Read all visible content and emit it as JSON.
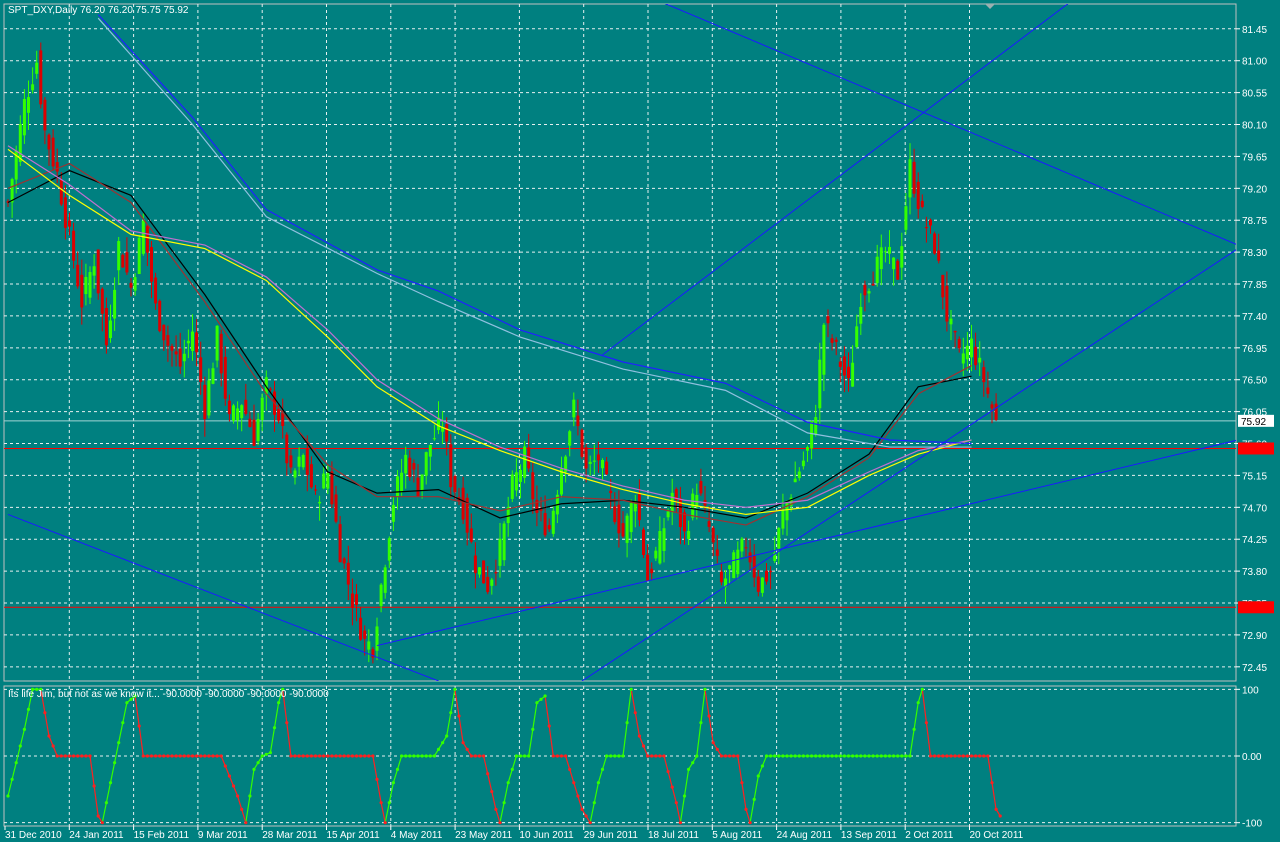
{
  "chart_data": [
    {
      "type": "candlestick",
      "title": "SPT_DXY,Daily  76.20 76.20 75.75 75.92",
      "ylim": [
        72.25,
        81.8
      ],
      "y_ticks": [
        "81.45",
        "81.00",
        "80.55",
        "80.10",
        "79.65",
        "79.20",
        "78.75",
        "78.30",
        "77.85",
        "77.40",
        "76.95",
        "76.50",
        "76.05",
        "75.60",
        "75.15",
        "74.70",
        "74.25",
        "73.80",
        "73.35",
        "72.90",
        "72.45"
      ],
      "x_ticks": [
        "31 Dec 2010",
        "24 Jan 2011",
        "15 Feb 2011",
        "9 Mar 2011",
        "28 Mar 2011",
        "15 Apr 2011",
        "4 May 2011",
        "23 May 2011",
        "10 Jun 2011",
        "29 Jun 2011",
        "18 Jul 2011",
        "5 Aug 2011",
        "24 Aug 2011",
        "13 Sep 2011",
        "2 Oct 2011",
        "20 Oct 2011"
      ],
      "price_labels": [
        {
          "text": "75.92",
          "value": 75.92,
          "color": "#ffffff",
          "text_color": "#000000"
        },
        {
          "text": "75.53",
          "value": 75.53,
          "color": "#ff0000",
          "text_color": "#ff0000"
        },
        {
          "text": "73.29",
          "value": 73.29,
          "color": "#ff0000",
          "text_color": "#ff0000"
        }
      ],
      "horizontal_lines": [
        {
          "value": 75.53,
          "color": "#ff0000"
        },
        {
          "value": 73.29,
          "color": "#ff0000"
        },
        {
          "value": 75.92,
          "color": "#9fd4d4"
        }
      ],
      "bar_up_color": "#33ff00",
      "bar_down_color": "#dd0000",
      "close_points": [
        [
          0,
          79.0
        ],
        [
          4,
          80.4
        ],
        [
          7,
          81.0
        ],
        [
          9,
          80.0
        ],
        [
          12,
          79.4
        ],
        [
          15,
          78.5
        ],
        [
          18,
          77.6
        ],
        [
          21,
          78.2
        ],
        [
          24,
          77.0
        ],
        [
          27,
          78.4
        ],
        [
          30,
          77.8
        ],
        [
          33,
          78.7
        ],
        [
          36,
          77.5
        ],
        [
          39,
          77.0
        ],
        [
          42,
          76.7
        ],
        [
          45,
          77.2
        ],
        [
          48,
          76.1
        ],
        [
          51,
          77.1
        ],
        [
          54,
          75.9
        ],
        [
          57,
          76.2
        ],
        [
          60,
          75.7
        ],
        [
          63,
          76.4
        ],
        [
          66,
          76.0
        ],
        [
          69,
          75.1
        ],
        [
          72,
          75.4
        ],
        [
          75,
          74.8
        ],
        [
          78,
          75.2
        ],
        [
          81,
          74.1
        ],
        [
          84,
          73.4
        ],
        [
          87,
          72.8
        ],
        [
          89,
          72.75
        ],
        [
          91,
          73.6
        ],
        [
          94,
          74.8
        ],
        [
          97,
          75.4
        ],
        [
          100,
          75.0
        ],
        [
          103,
          75.6
        ],
        [
          106,
          75.9
        ],
        [
          108,
          75.1
        ],
        [
          111,
          74.7
        ],
        [
          114,
          73.9
        ],
        [
          117,
          73.6
        ],
        [
          120,
          74.1
        ],
        [
          123,
          75.0
        ],
        [
          126,
          75.4
        ],
        [
          129,
          74.6
        ],
        [
          132,
          74.4
        ],
        [
          135,
          75.3
        ],
        [
          138,
          76.1
        ],
        [
          141,
          75.2
        ],
        [
          144,
          75.4
        ],
        [
          147,
          74.8
        ],
        [
          150,
          74.3
        ],
        [
          153,
          74.9
        ],
        [
          156,
          73.7
        ],
        [
          159,
          74.2
        ],
        [
          162,
          74.9
        ],
        [
          165,
          74.3
        ],
        [
          168,
          75.0
        ],
        [
          171,
          74.4
        ],
        [
          174,
          73.6
        ],
        [
          177,
          73.9
        ],
        [
          180,
          74.2
        ],
        [
          183,
          73.6
        ],
        [
          186,
          73.8
        ],
        [
          189,
          74.6
        ],
        [
          192,
          75.1
        ],
        [
          195,
          75.5
        ],
        [
          197,
          76.1
        ],
        [
          199,
          77.3
        ],
        [
          202,
          76.9
        ],
        [
          205,
          76.4
        ],
        [
          208,
          77.7
        ],
        [
          211,
          78.0
        ],
        [
          214,
          78.3
        ],
        [
          217,
          78.0
        ],
        [
          220,
          79.5
        ],
        [
          223,
          78.8
        ],
        [
          226,
          78.4
        ],
        [
          229,
          77.4
        ],
        [
          232,
          76.8
        ],
        [
          235,
          77.0
        ],
        [
          238,
          76.5
        ],
        [
          241,
          75.9
        ]
      ],
      "series": [
        {
          "color": "#000000",
          "values": [
            [
              0,
              79.0
            ],
            [
              15,
              79.45
            ],
            [
              30,
              79.1
            ],
            [
              48,
              77.7
            ],
            [
              63,
              76.4
            ],
            [
              78,
              75.2
            ],
            [
              90,
              74.9
            ],
            [
              105,
              74.95
            ],
            [
              120,
              74.55
            ],
            [
              135,
              74.75
            ],
            [
              150,
              74.8
            ],
            [
              165,
              74.7
            ],
            [
              180,
              74.55
            ],
            [
              195,
              74.9
            ],
            [
              210,
              75.45
            ],
            [
              222,
              76.4
            ],
            [
              235,
              76.55
            ]
          ]
        },
        {
          "color": "#a03030",
          "values": [
            [
              0,
              79.2
            ],
            [
              15,
              79.55
            ],
            [
              30,
              79.0
            ],
            [
              48,
              77.6
            ],
            [
              63,
              76.3
            ],
            [
              78,
              75.3
            ],
            [
              90,
              74.85
            ],
            [
              105,
              74.85
            ],
            [
              120,
              74.65
            ],
            [
              135,
              74.85
            ],
            [
              150,
              74.8
            ],
            [
              165,
              74.6
            ],
            [
              180,
              74.45
            ],
            [
              195,
              74.85
            ],
            [
              210,
              75.4
            ],
            [
              222,
              76.3
            ],
            [
              235,
              76.7
            ]
          ]
        },
        {
          "color": "#ffff00",
          "values": [
            [
              0,
              79.75
            ],
            [
              15,
              79.1
            ],
            [
              30,
              78.55
            ],
            [
              48,
              78.35
            ],
            [
              63,
              77.9
            ],
            [
              78,
              77.1
            ],
            [
              90,
              76.4
            ],
            [
              105,
              75.85
            ],
            [
              120,
              75.5
            ],
            [
              135,
              75.2
            ],
            [
              150,
              74.95
            ],
            [
              165,
              74.75
            ],
            [
              180,
              74.6
            ],
            [
              195,
              74.7
            ],
            [
              210,
              75.15
            ],
            [
              222,
              75.45
            ],
            [
              235,
              75.65
            ]
          ]
        },
        {
          "color": "#c070d0",
          "values": [
            [
              0,
              79.8
            ],
            [
              15,
              79.25
            ],
            [
              30,
              78.6
            ],
            [
              48,
              78.4
            ],
            [
              63,
              77.95
            ],
            [
              78,
              77.2
            ],
            [
              90,
              76.5
            ],
            [
              105,
              75.95
            ],
            [
              120,
              75.55
            ],
            [
              135,
              75.25
            ],
            [
              150,
              75.0
            ],
            [
              165,
              74.8
            ],
            [
              180,
              74.7
            ],
            [
              195,
              74.8
            ],
            [
              210,
              75.2
            ],
            [
              222,
              75.5
            ],
            [
              235,
              75.65
            ]
          ]
        },
        {
          "color": "#2020ff",
          "values": [
            [
              22,
              81.65
            ],
            [
              45,
              80.2
            ],
            [
              63,
              78.9
            ],
            [
              90,
              78.05
            ],
            [
              105,
              77.75
            ],
            [
              125,
              77.2
            ],
            [
              150,
              76.75
            ],
            [
              175,
              76.45
            ],
            [
              195,
              75.9
            ],
            [
              215,
              75.65
            ],
            [
              235,
              75.6
            ]
          ]
        },
        {
          "color": "#90c0e0",
          "values": [
            [
              22,
              81.6
            ],
            [
              45,
              80.1
            ],
            [
              63,
              78.8
            ],
            [
              90,
              78.0
            ],
            [
              105,
              77.6
            ],
            [
              125,
              77.1
            ],
            [
              150,
              76.65
            ],
            [
              175,
              76.35
            ],
            [
              195,
              75.75
            ],
            [
              215,
              75.55
            ],
            [
              235,
              75.55
            ]
          ]
        }
      ],
      "trendlines": [
        {
          "color": "#1a1aff",
          "points": [
            [
              0,
              74.6
            ],
            [
              105,
              72.25
            ]
          ]
        },
        {
          "color": "#1a1aff",
          "points": [
            [
              90,
              72.75
            ],
            [
              300,
              75.65
            ]
          ]
        },
        {
          "color": "#1a1aff",
          "points": [
            [
              140,
              72.25
            ],
            [
              300,
              78.35
            ]
          ]
        },
        {
          "color": "#1a1aff",
          "points": [
            [
              145,
              76.85
            ],
            [
              263,
              82.0
            ]
          ]
        },
        {
          "color": "#1a1aff",
          "points": [
            [
              140,
              82.3
            ],
            [
              300,
              78.4
            ]
          ]
        }
      ]
    },
    {
      "type": "line",
      "title": "Its life Jim, but not as we know it...  -90.0000 -90.0000 -90.0000 -90.0000",
      "ylim": [
        -105,
        105
      ],
      "y_ticks": [
        "100",
        "0.00",
        "-100"
      ],
      "up_color": "#33ff00",
      "down_color": "#ff2020",
      "values": [
        [
          0,
          -60,
          "up"
        ],
        [
          2,
          -10,
          "up"
        ],
        [
          4,
          40,
          "up"
        ],
        [
          6,
          100,
          "up"
        ],
        [
          8,
          100,
          "down"
        ],
        [
          10,
          30,
          "down"
        ],
        [
          12,
          0,
          "down"
        ],
        [
          15,
          0,
          "down"
        ],
        [
          18,
          0,
          "down"
        ],
        [
          20,
          0,
          "down"
        ],
        [
          22,
          -90,
          "down"
        ],
        [
          23,
          -100,
          "up"
        ],
        [
          25,
          -40,
          "up"
        ],
        [
          27,
          20,
          "up"
        ],
        [
          29,
          80,
          "up"
        ],
        [
          31,
          90,
          "down"
        ],
        [
          33,
          0,
          "down"
        ],
        [
          36,
          0,
          "down"
        ],
        [
          40,
          0,
          "down"
        ],
        [
          44,
          0,
          "down"
        ],
        [
          48,
          0,
          "down"
        ],
        [
          52,
          0,
          "down"
        ],
        [
          56,
          -60,
          "down"
        ],
        [
          58,
          -100,
          "up"
        ],
        [
          60,
          -20,
          "up"
        ],
        [
          62,
          0,
          "up"
        ],
        [
          64,
          5,
          "up"
        ],
        [
          66,
          80,
          "up"
        ],
        [
          67,
          100,
          "down"
        ],
        [
          69,
          0,
          "down"
        ],
        [
          73,
          0,
          "down"
        ],
        [
          77,
          0,
          "down"
        ],
        [
          81,
          0,
          "down"
        ],
        [
          85,
          0,
          "down"
        ],
        [
          89,
          0,
          "down"
        ],
        [
          91,
          -70,
          "down"
        ],
        [
          92,
          -100,
          "up"
        ],
        [
          94,
          -40,
          "up"
        ],
        [
          96,
          0,
          "up"
        ],
        [
          100,
          0,
          "up"
        ],
        [
          104,
          0,
          "up"
        ],
        [
          107,
          30,
          "up"
        ],
        [
          109,
          100,
          "down"
        ],
        [
          111,
          20,
          "down"
        ],
        [
          113,
          0,
          "down"
        ],
        [
          116,
          0,
          "down"
        ],
        [
          119,
          -80,
          "down"
        ],
        [
          120,
          -100,
          "up"
        ],
        [
          122,
          -40,
          "up"
        ],
        [
          124,
          0,
          "up"
        ],
        [
          127,
          0,
          "up"
        ],
        [
          129,
          80,
          "up"
        ],
        [
          131,
          90,
          "down"
        ],
        [
          133,
          0,
          "down"
        ],
        [
          136,
          0,
          "down"
        ],
        [
          140,
          -80,
          "down"
        ],
        [
          142,
          -100,
          "up"
        ],
        [
          144,
          -40,
          "up"
        ],
        [
          146,
          0,
          "up"
        ],
        [
          150,
          0,
          "up"
        ],
        [
          152,
          100,
          "down"
        ],
        [
          154,
          30,
          "down"
        ],
        [
          156,
          0,
          "down"
        ],
        [
          160,
          0,
          "down"
        ],
        [
          163,
          -70,
          "down"
        ],
        [
          164,
          -100,
          "up"
        ],
        [
          166,
          -20,
          "up"
        ],
        [
          168,
          0,
          "up"
        ],
        [
          170,
          100,
          "down"
        ],
        [
          172,
          20,
          "down"
        ],
        [
          174,
          0,
          "down"
        ],
        [
          178,
          0,
          "down"
        ],
        [
          180,
          -80,
          "down"
        ],
        [
          181,
          -100,
          "up"
        ],
        [
          183,
          -30,
          "up"
        ],
        [
          185,
          0,
          "up"
        ],
        [
          190,
          0,
          "up"
        ],
        [
          195,
          0,
          "up"
        ],
        [
          200,
          0,
          "up"
        ],
        [
          205,
          0,
          "up"
        ],
        [
          210,
          0,
          "up"
        ],
        [
          215,
          0,
          "up"
        ],
        [
          220,
          0,
          "up"
        ],
        [
          222,
          80,
          "up"
        ],
        [
          223,
          100,
          "down"
        ],
        [
          225,
          0,
          "down"
        ],
        [
          230,
          0,
          "down"
        ],
        [
          235,
          0,
          "down"
        ],
        [
          239,
          0,
          "down"
        ],
        [
          241,
          -80,
          "down"
        ],
        [
          242,
          -90,
          "down"
        ]
      ]
    }
  ]
}
